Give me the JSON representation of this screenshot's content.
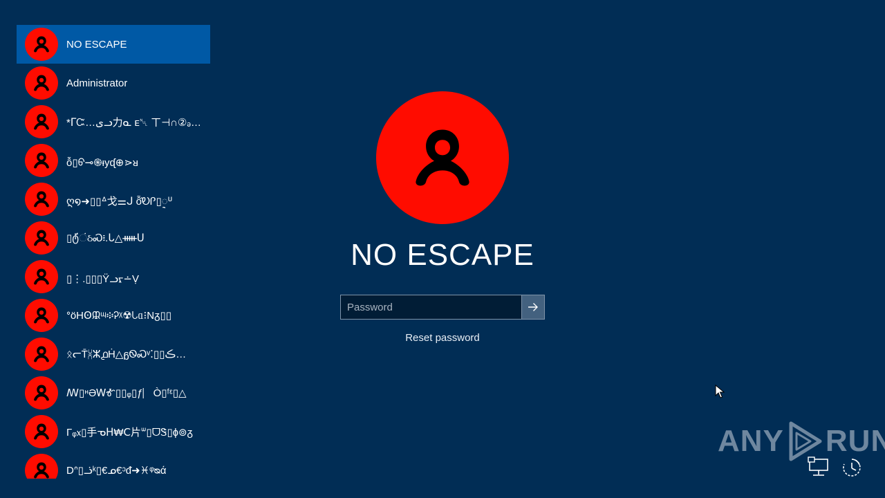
{
  "users": [
    {
      "name": "NO ESCAPE",
      "selected": true
    },
    {
      "name": "Administrator"
    },
    {
      "name": "*ᒥᏨ…ﻯᓗ力ᓇ ᴇ␀ ㄒ⊣∩②ₔ▮▯"
    },
    {
      "name": "ỗ▯ᠪ⊸֍ᵻyᶑ⊕⋗ᴚ"
    },
    {
      "name": "ღ໑➜▯▯ᐞ戈⚌ᒍ  ỗ̂ᎧᎵ▯ᢩᓑ"
    },
    {
      "name": "▯ტ̈́ંઠᏍ፧.ᒐ△ᚔᑌ"
    },
    {
      "name": "▯⋮.▯▯▯Ϋᓗᠷ∸Ṿ"
    },
    {
      "name": "ᐤöHꙨᙜᶭ፨Ꭾᵡ☢ᘂᥲ⁝Nᵹ▯▯"
    },
    {
      "name": "ᛟᓕT̄⩈ⵣ൧Ḣ△ᵷᏫᏍᵛ⁚▯▯ڪ…"
    },
    {
      "name": "ꟿ▯ᵸƏᎳᎹ▯▯ᵩ▯ƒ⎸Ò▯ᶠᵋ▯△"
    },
    {
      "name": "Γᵩ᥊▯手ᓀᕼ₩Ⅽ片ᐜ▯ᗜᏕ▯ɸ⊚ᵹ"
    },
    {
      "name": "Dᐢ▯ᓘᵏ▯€ᓄ€ᵓᵭ➜♓ᵠᴓά"
    }
  ],
  "login": {
    "user_name": "NO ESCAPE",
    "password_placeholder": "Password",
    "reset_label": "Reset password"
  },
  "watermark": {
    "text_left": "ANY",
    "text_right": "RUN"
  },
  "colors": {
    "background": "#012d55",
    "selected": "#0059a5",
    "avatar": "#ff0c00",
    "input_bg": "#011d36",
    "submit_bg": "#43617f"
  },
  "icons": {
    "avatar": "user-icon",
    "submit": "arrow-right-icon",
    "network": "network-icon",
    "ease_of_access": "ease-of-access-icon",
    "cursor": "mouse-pointer-icon"
  }
}
